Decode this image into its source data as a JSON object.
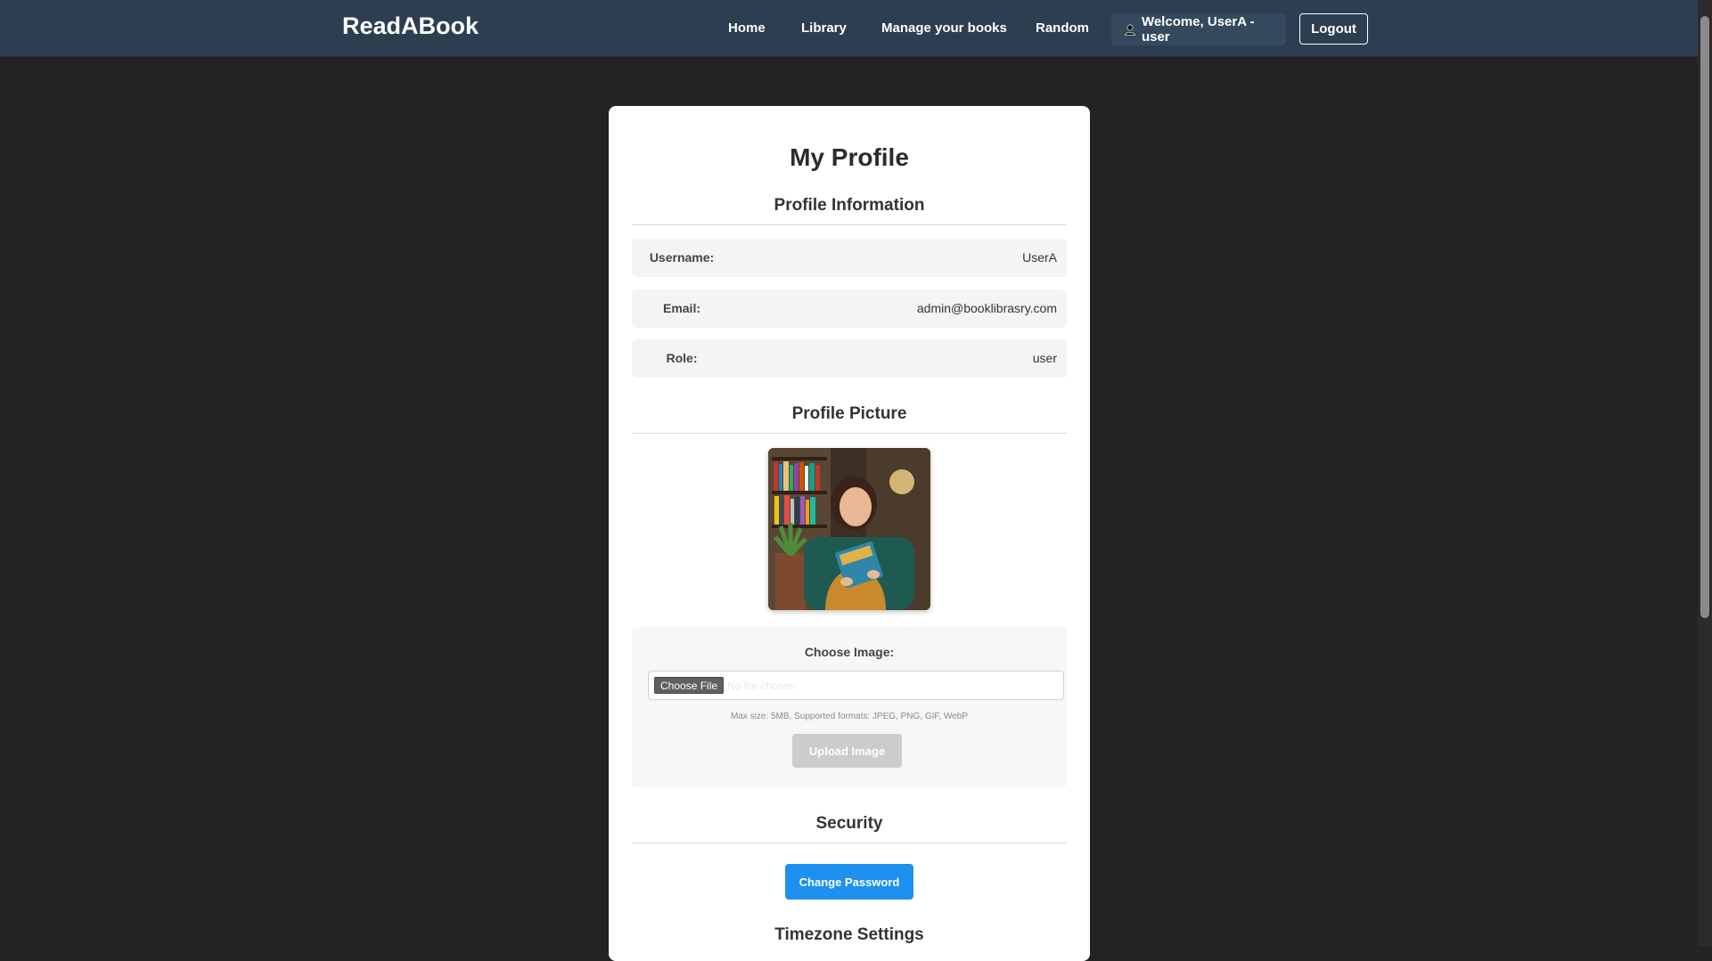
{
  "navbar": {
    "brand": "ReadABook",
    "links": [
      "Home",
      "Library",
      "Manage your books",
      "Random"
    ],
    "welcome": "Welcome, UserA - user",
    "logout": "Logout"
  },
  "profile": {
    "title": "My Profile",
    "info_heading": "Profile Information",
    "fields": [
      {
        "label": "Username:",
        "value": "UserA"
      },
      {
        "label": "Email:",
        "value": "admin@booklibrasry.com"
      },
      {
        "label": "Role:",
        "value": "user"
      }
    ],
    "picture_heading": "Profile Picture",
    "choose_label": "Choose Image:",
    "file_button": "Choose File",
    "file_status": "No file chosen",
    "hint": "Max size: 5MB, Supported formats: JPEG, PNG, GIF, WebP",
    "upload_button": "Upload Image",
    "security_heading": "Security",
    "change_password": "Change Password",
    "timezone_heading": "Timezone Settings"
  },
  "colors": {
    "navbar": "#2c3e50",
    "background": "#232323",
    "primary": "#1e90ef",
    "disabled": "#cccccc"
  }
}
